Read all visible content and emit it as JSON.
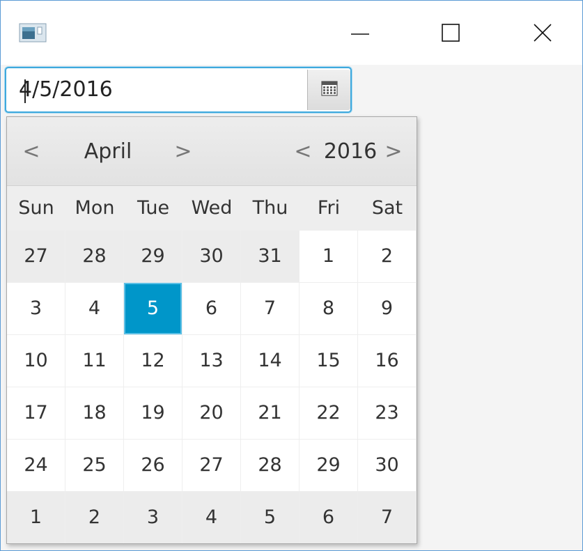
{
  "window": {
    "icon": "java-app-icon",
    "controls": {
      "minimize": "minimize-icon",
      "maximize": "maximize-icon",
      "close": "close-icon"
    }
  },
  "date_picker": {
    "value": "4/5/2016",
    "button_icon": "calendar-icon"
  },
  "calendar": {
    "month": "April",
    "year": "2016",
    "prev_month": "<",
    "next_month": ">",
    "prev_year": "<",
    "next_year": ">",
    "weekdays": [
      "Sun",
      "Mon",
      "Tue",
      "Wed",
      "Thu",
      "Fri",
      "Sat"
    ],
    "weeks": [
      [
        "27",
        "28",
        "29",
        "30",
        "31",
        "1",
        "2"
      ],
      [
        "3",
        "4",
        "5",
        "6",
        "7",
        "8",
        "9"
      ],
      [
        "10",
        "11",
        "12",
        "13",
        "14",
        "15",
        "16"
      ],
      [
        "17",
        "18",
        "19",
        "20",
        "21",
        "22",
        "23"
      ],
      [
        "24",
        "25",
        "26",
        "27",
        "28",
        "29",
        "30"
      ],
      [
        "1",
        "2",
        "3",
        "4",
        "5",
        "6",
        "7"
      ]
    ],
    "selected": "5",
    "colors": {
      "selected_bg": "#0096c9",
      "focus_border": "#3fa9dd",
      "other_month_bg": "#ececec"
    }
  }
}
